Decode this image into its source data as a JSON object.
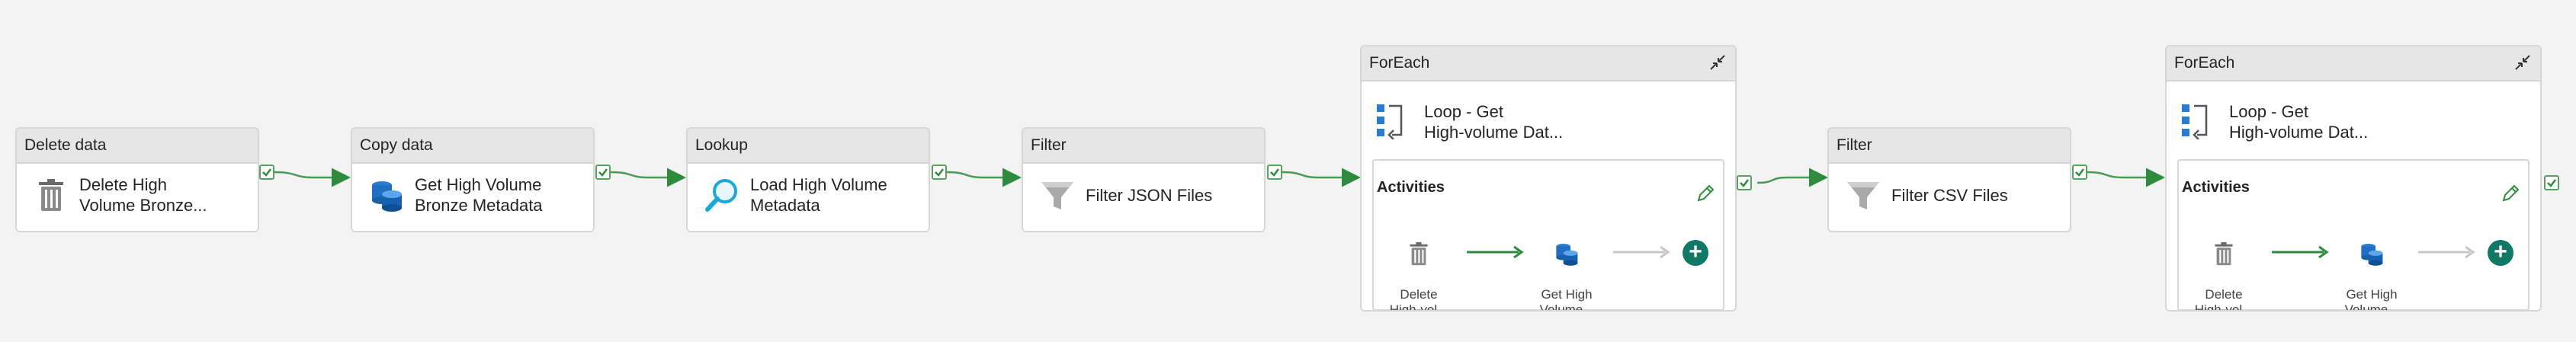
{
  "activities": [
    {
      "type": "Delete data",
      "label": "Delete High\nVolume Bronze...",
      "icon": "trash-icon"
    },
    {
      "type": "Copy data",
      "label": "Get High Volume\nBronze Metadata",
      "icon": "database-stack-icon"
    },
    {
      "type": "Lookup",
      "label": "Load High Volume\nMetadata",
      "icon": "magnifier-icon"
    },
    {
      "type": "Filter",
      "label": "Filter JSON Files",
      "icon": "funnel-icon"
    },
    {
      "type": "Filter",
      "label": "Filter CSV Files",
      "icon": "funnel-icon"
    }
  ],
  "foreach": [
    {
      "type": "ForEach",
      "label": "Loop - Get\nHigh-volume Dat...",
      "inner_title": "Activities",
      "inner_items": [
        {
          "label": "Delete\nHigh-vol...",
          "icon": "trash-icon"
        },
        {
          "label": "Get High\nVolume...",
          "icon": "database-stack-icon"
        }
      ]
    },
    {
      "type": "ForEach",
      "label": "Loop - Get\nHigh-volume Dat...",
      "inner_title": "Activities",
      "inner_items": [
        {
          "label": "Delete\nHigh-vol...",
          "icon": "trash-icon"
        },
        {
          "label": "Get High\nVolume...",
          "icon": "database-stack-icon"
        }
      ]
    }
  ],
  "colors": {
    "success_green": "#2e8b3e",
    "add_button": "#117865",
    "header_gray": "#e6e6e6",
    "canvas": "#f3f3f3"
  }
}
